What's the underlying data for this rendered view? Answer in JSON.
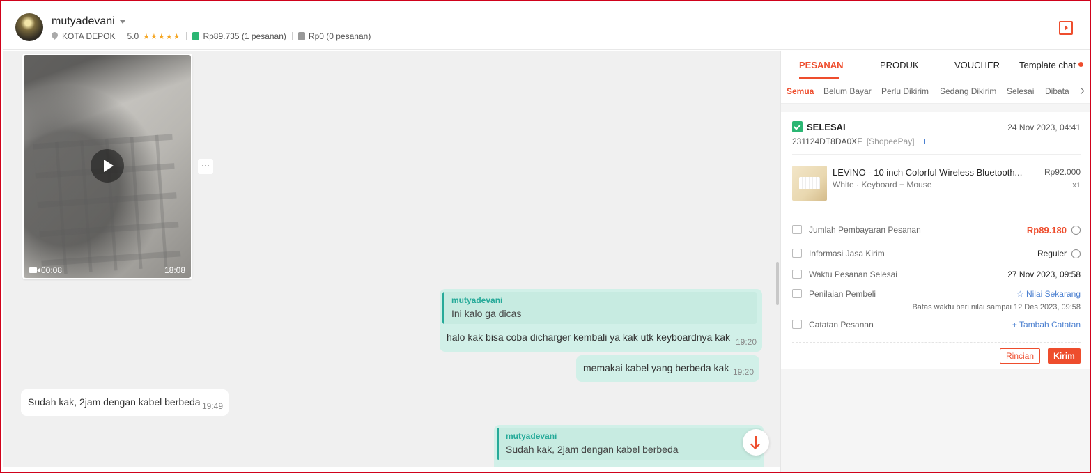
{
  "header": {
    "username": "mutyadevani",
    "location": "KOTA DEPOK",
    "rating": "5.0",
    "stars": "★★★★★",
    "paid_amount": "Rp89.735",
    "paid_orders": "(1 pesanan)",
    "unpaid_amount": "Rp0",
    "unpaid_orders": "(0 pesanan)"
  },
  "video": {
    "duration": "00:08",
    "time": "18:08",
    "more_label": "···"
  },
  "messages": [
    {
      "quote_name": "mutyadevani",
      "quote_text": "Ini kalo ga dicas",
      "text": "halo kak bisa coba dicharger kembali ya kak utk keyboardnya kak",
      "time": "19:20"
    },
    {
      "text": "memakai kabel yang berbeda kak",
      "time": "19:20"
    },
    {
      "text": "Sudah kak, 2jam dengan kabel berbeda",
      "time": "19:49"
    },
    {
      "quote_name": "mutyadevani",
      "quote_text": "Sudah kak, 2jam dengan kabel berbeda"
    }
  ],
  "panel": {
    "tabs": [
      "PESANAN",
      "PRODUK",
      "VOUCHER",
      "Template chat"
    ],
    "subtabs": [
      "Semua",
      "Belum Bayar",
      "Perlu Dikirim",
      "Sedang Dikirim",
      "Selesai",
      "Dibata"
    ],
    "order": {
      "status": "SELESAI",
      "date": "24 Nov 2023, 04:41",
      "id": "231124DT8DA0XF",
      "payment": "[ShopeePay]",
      "product_name": "LEVINO - 10 inch Colorful Wireless Bluetooth...",
      "product_variant": "White · Keyboard + Mouse",
      "product_price": "Rp92.000",
      "product_qty": "x1",
      "rows": {
        "total_label": "Jumlah Pembayaran Pesanan",
        "total_value": "Rp89.180",
        "shipping_label": "Informasi Jasa Kirim",
        "shipping_value": "Reguler",
        "completed_label": "Waktu Pesanan Selesai",
        "completed_value": "27 Nov 2023, 09:58",
        "review_label": "Penilaian Pembeli",
        "review_value": "☆ Nilai Sekarang",
        "review_note": "Batas waktu beri nilai sampai 12 Des 2023, 09:58",
        "notes_label": "Catatan Pesanan",
        "notes_value": "+ Tambah Catatan"
      },
      "btn_details": "Rincian",
      "btn_send": "Kirim"
    }
  },
  "colors": {
    "accent": "#ee4d2d",
    "teal": "#26aa99",
    "bubble_out": "#d1f0e8",
    "chat_bg": "#f0f0f0"
  }
}
